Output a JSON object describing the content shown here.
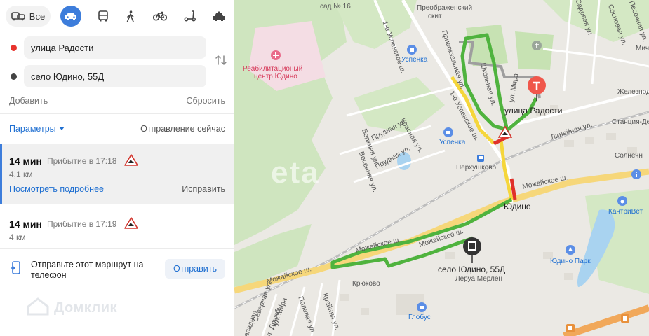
{
  "modes": {
    "all_label": "Все",
    "items": [
      {
        "name": "car-icon",
        "selected": true
      },
      {
        "name": "bus-icon"
      },
      {
        "name": "walk-icon"
      },
      {
        "name": "bike-icon"
      },
      {
        "name": "scooter-icon"
      },
      {
        "name": "taxi-icon"
      }
    ]
  },
  "route_points": {
    "from": "улица Радости",
    "to": "село Юдино, 55Д"
  },
  "actions": {
    "add": "Добавить",
    "reset": "Сбросить",
    "params": "Параметры",
    "departure": "Отправление сейчас"
  },
  "routes": [
    {
      "duration": "14 мин",
      "arrival": "Прибытие в 17:18",
      "distance": "4,1 км",
      "details": "Посмотреть подробнее",
      "fix": "Исправить",
      "selected": true
    },
    {
      "duration": "14 мин",
      "arrival": "Прибытие в 17:19",
      "distance": "4 км"
    }
  ],
  "send": {
    "text": "Отправьте этот маршрут на телефон",
    "button": "Отправить"
  },
  "watermark": "Домклик",
  "map": {
    "eta_watermark": "eta",
    "labels": {
      "sad16": "сад № 16",
      "preobr": "Преображенский",
      "skit": "скит",
      "rehab1": "Реабилитационый",
      "rehab2": "центр Юдино",
      "uspenka1": "Успенка",
      "uspenka2": "Успенка",
      "perkh": "Перхушково",
      "udino": "Юдино",
      "ulRadosti": "улица Радости",
      "zhel": "Железнодор",
      "stanciya": "Станция-Де",
      "solnech": "Солнечн",
      "mich": "Мич",
      "kantrivet": "КантриВет",
      "udinoPark": "Юдино Парк",
      "mozh1": "Можайское ш.",
      "mozh2": "Можайское ш.",
      "mozh3": "Можайское ш.",
      "mozh4": "Можайское ш.",
      "kryukovo": "Крюково",
      "dest": "село Юдино, 55Д",
      "leroy": "Леруа Мерлен",
      "globus": "Глобус",
      "uspShosse": "1-е Успенское ш.",
      "uspShosse2": "1-е Успенское ш.",
      "prudnaya": "Прудная ул.",
      "prudnaya2": "Прудная ул.",
      "krasnaya": "Красная ул.",
      "vesennyaya": "Весенняя ул.",
      "verkhnyaya": "Верхняя ул.",
      "linejnaya": "Линейная ул.",
      "shkolnaya": "Школьная ул.",
      "privokz": "Привокзальная ул.",
      "ulMira": "ул. Мира",
      "ulMira2": "ул. Мира",
      "severnaya": "Северная ул.",
      "ulDruzhby": "ул. Дружбы",
      "polevaya": "Полевая ул.",
      "krajnyaya": "Крайняя ул.",
      "zapadnaya": "Западная",
      "sadovaya": "Садовая ул.",
      "sosnovaya": "Сосновая ул.",
      "pesochn": "Песочная ул."
    }
  },
  "colors": {
    "accent": "#3d7ddb",
    "route_green": "#4fb33e",
    "route_yellow": "#f5d63b",
    "route_red": "#e0312a",
    "pin_red": "#f0574b"
  }
}
